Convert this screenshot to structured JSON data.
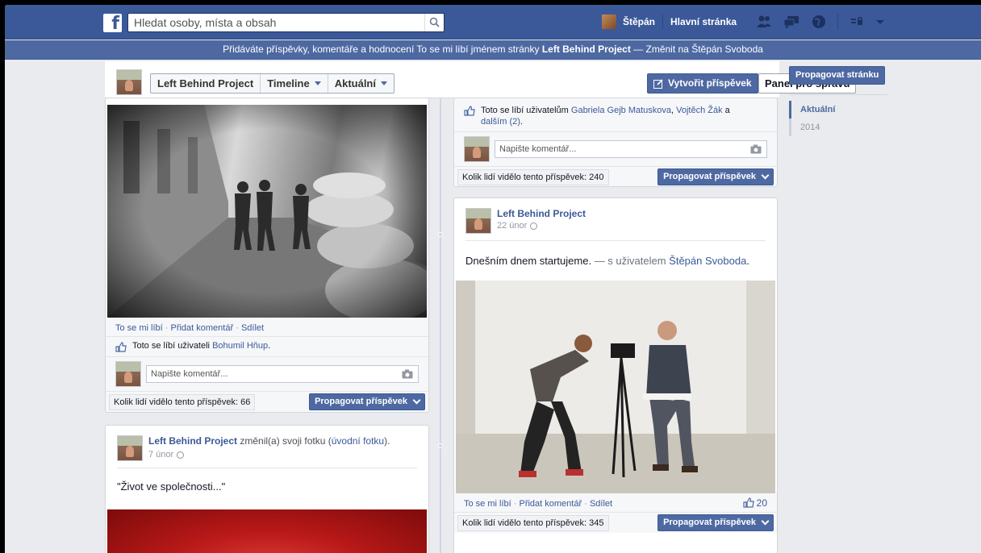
{
  "topbar": {
    "search_placeholder": "Hledat osoby, místa a obsah",
    "user_name": "Štěpán",
    "home_label": "Hlavní stránka"
  },
  "acting_bar": {
    "prefix": "Přidáváte příspěvky, komentáře a hodnocení To se mi líbí jménem stránky ",
    "page_name": "Left Behind Project",
    "separator": " — ",
    "switch_text": "Změnit na Štěpán Svoboda"
  },
  "page_header": {
    "tabs": [
      "Left Behind Project",
      "Timeline",
      "Aktuální"
    ],
    "create_post": "Vytvořit příspěvek",
    "admin_panel": "Panel pro správu"
  },
  "sidebar": {
    "promote_page": "Propagovat stránku",
    "timeline_items": [
      "Aktuální",
      "2014"
    ]
  },
  "ufi": {
    "like": "To se mi líbí",
    "comment": "Přidat komentář",
    "share": "Sdílet",
    "comment_placeholder": "Napište komentář...",
    "promote_post": "Propagovat příspěvek",
    "reach_prefix": "Kolik lidí vidělo tento příspěvek: "
  },
  "post_left_1": {
    "likes_prefix": "Toto se líbí uživateli ",
    "likes_user": "Bohumil Hňup",
    "likes_suffix": ".",
    "reach": "Kolik lidí vidělo tento příspěvek: 66"
  },
  "post_left_2": {
    "author": "Left Behind Project",
    "action_1": " změnil(a) svoji fotku (",
    "action_link": "úvodní fotku",
    "action_2": ").",
    "date": "7 únor",
    "text": "\"Život ve společnosti...\""
  },
  "post_right_1": {
    "likes_prefix": "Toto se líbí uživatelům ",
    "user_a": "Gabriela Gejb Matuskova",
    "comma": ", ",
    "user_b": "Vojtěch Žák",
    "and": " a",
    "others": "dalším (2)",
    "end": ".",
    "reach": "Kolik lidí vidělo tento příspěvek: 240"
  },
  "post_right_2": {
    "author": "Left Behind Project",
    "date": "22 únor",
    "text_main": "Dnešním dnem startujeme.",
    "text_with": " — s uživatelem ",
    "tagged": "Štěpán Svoboda",
    "tagged_end": ".",
    "like_count": "20",
    "reach": "Kolik lidí vidělo tento příspěvek: 345"
  },
  "colors": {
    "brand": "#3b5998",
    "acting_bar": "#4e69a2",
    "background": "#e9ebee"
  },
  "icons": [
    "facebook-logo-icon",
    "search-icon",
    "friends-icon",
    "messages-icon",
    "globe-icon",
    "privacy-icon",
    "chevron-down-icon",
    "pencil-icon",
    "like-icon",
    "camera-icon"
  ]
}
